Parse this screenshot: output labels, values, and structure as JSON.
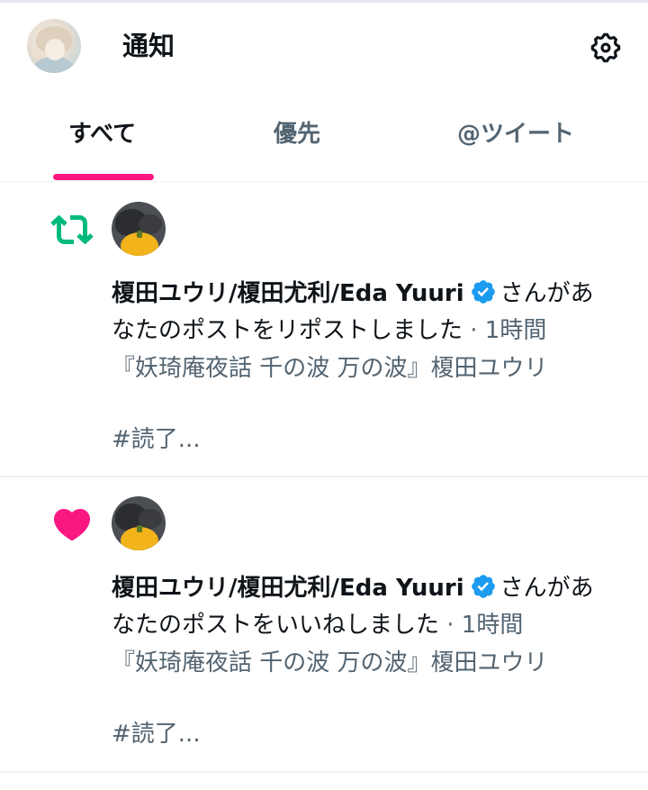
{
  "header": {
    "title": "通知",
    "avatar_icon": "user-avatar-illustration",
    "settings_icon": "gear-icon"
  },
  "tabs": [
    {
      "label": "すべて",
      "active": true
    },
    {
      "label": "優先",
      "active": false
    },
    {
      "label": "@ツイート",
      "active": false
    }
  ],
  "colors": {
    "accent_pink": "#f91880",
    "retweet_green": "#00ba7c",
    "verified_blue": "#1d9bf0",
    "secondary_text": "#536471"
  },
  "notifications": [
    {
      "type_icon": "retweet-icon",
      "user_name": "榎田ユウリ/榎田尤利/Eda Yuuri",
      "verified": true,
      "action_line1": "さんがあ",
      "action_line2": "なたのポストをリポストしました",
      "time": " · 1時間",
      "snippet": "『妖琦庵夜話 千の波 万の波』榎田ユウリ",
      "tag": "#読了..."
    },
    {
      "type_icon": "heart-icon",
      "user_name": "榎田ユウリ/榎田尤利/Eda Yuuri",
      "verified": true,
      "action_line1": "さんがあ",
      "action_line2": "なたのポストをいいねしました",
      "time": " · 1時間",
      "snippet": "『妖琦庵夜話 千の波 万の波』榎田ユウリ",
      "tag": "#読了..."
    }
  ]
}
